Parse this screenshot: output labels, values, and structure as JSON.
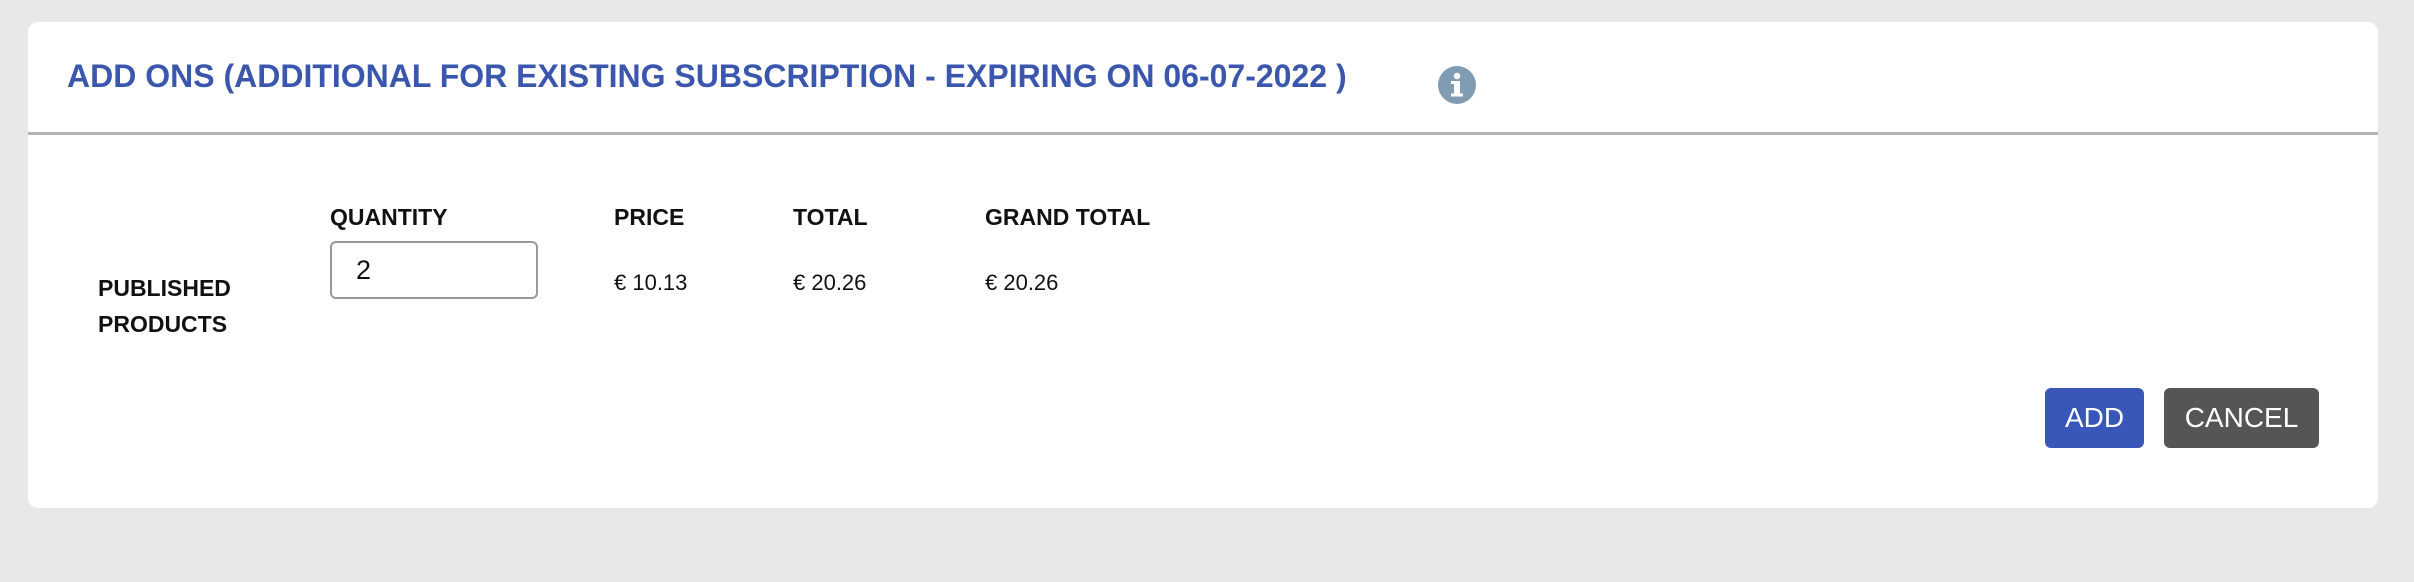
{
  "dialog": {
    "title": "ADD ONS (ADDITIONAL FOR EXISTING SUBSCRIPTION - EXPIRING ON 06-07-2022 )",
    "info_icon": "info-circle-icon"
  },
  "table": {
    "headers": {
      "quantity": "QUANTITY",
      "price": "PRICE",
      "total": "TOTAL",
      "grand_total": "GRAND TOTAL"
    },
    "row": {
      "label_line1": "PUBLISHED",
      "label_line2": "PRODUCTS",
      "quantity": "2",
      "price": "€ 10.13",
      "total": "€ 20.26",
      "grand_total": "€ 20.26"
    }
  },
  "actions": {
    "add_label": "ADD",
    "cancel_label": "CANCEL"
  },
  "colors": {
    "title": "#3a56ad",
    "add_button": "#3857b8",
    "cancel_button": "#555555",
    "info_icon": "#7f9cb3",
    "background": "#e8e8e8"
  }
}
